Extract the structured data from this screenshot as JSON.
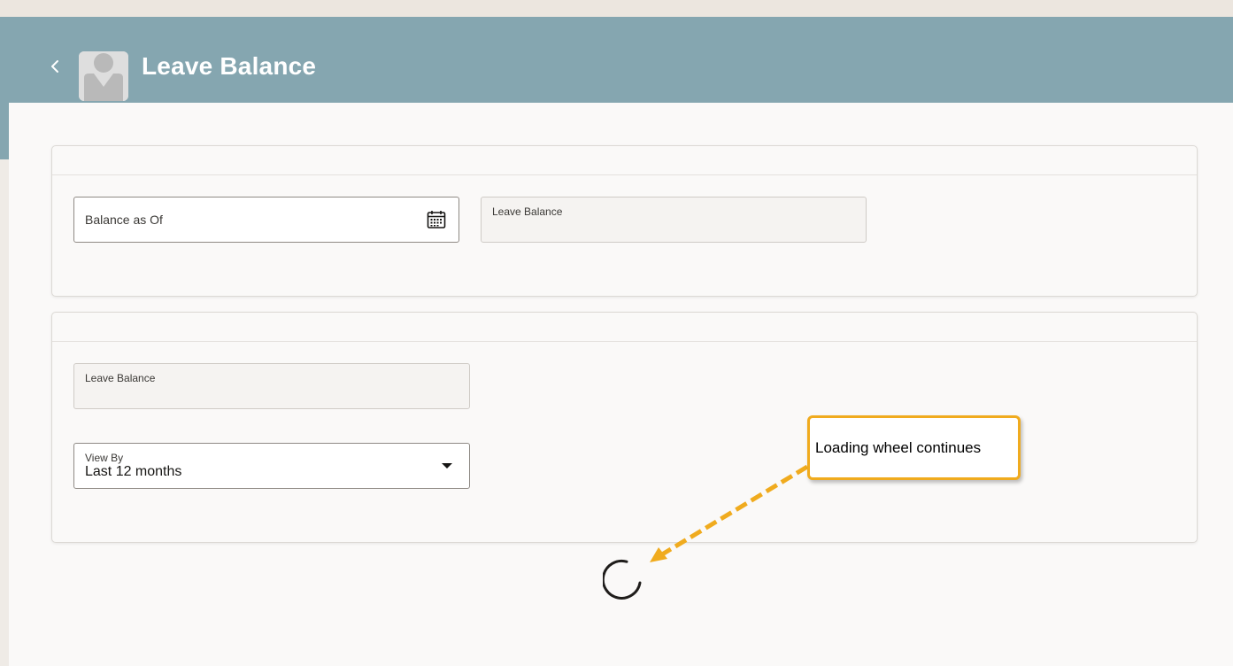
{
  "header": {
    "title": "Leave Balance",
    "back_icon": "chevron-left-icon",
    "avatar_icon": "person-silhouette-icon"
  },
  "card1": {
    "balance_as_of": {
      "placeholder": "Balance as Of",
      "icon": "calendar-icon"
    },
    "leave_balance": {
      "label": "Leave Balance",
      "value": ""
    }
  },
  "card2": {
    "leave_balance": {
      "label": "Leave Balance",
      "value": ""
    },
    "view_by": {
      "label": "View By",
      "value": "Last 12 months",
      "icon": "caret-down-icon"
    }
  },
  "loading": {
    "icon": "loading-spinner-icon"
  },
  "annotation": {
    "text": "Loading wheel continues",
    "border_color": "#f0ab1e"
  },
  "colors": {
    "header_bg": "#85a6b0",
    "content_bg": "#faf9f8"
  }
}
